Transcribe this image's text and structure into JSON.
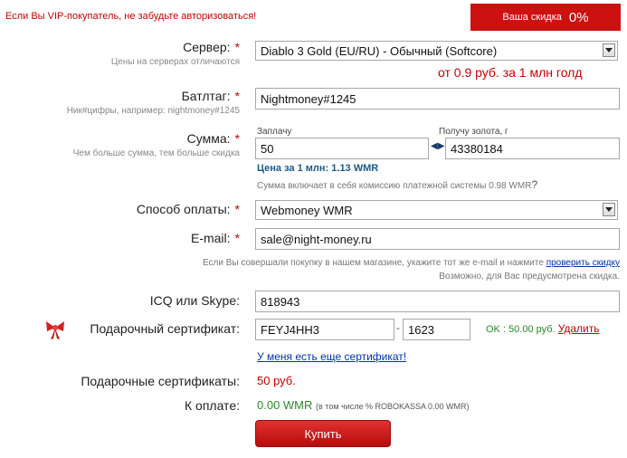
{
  "vip_notice": "Если Вы VIP-покупатель, не забудьте авторизоваться!",
  "discount": {
    "label": "Ваша скидка",
    "value": "0%"
  },
  "server": {
    "label": "Сервер:",
    "hint": "Цены на серверах отличаются",
    "selected": "Diablo 3 Gold (EU/RU) - Обычный (Softcore)",
    "price": "от 0.9 руб. за 1 млн голд"
  },
  "battletag": {
    "label": "Батлтаг:",
    "hint": "Ник#цифры, например: nightmoney#1245",
    "value": "Nightmoney#1245"
  },
  "sum": {
    "label": "Сумма:",
    "hint": "Чем больше сумма, тем больше скидка",
    "pay_label": "Заплачу",
    "pay_value": "50",
    "receive_label": "Получу золота, г",
    "receive_value": "43380184",
    "price_line": "Цена за 1 млн: 1.13 WMR",
    "commission_note": "Сумма включает в себя комиссию платежной системы 0.98 WMR",
    "question": "?"
  },
  "payment": {
    "label": "Способ оплаты:",
    "selected": "Webmoney WMR"
  },
  "email": {
    "label": "E-mail:",
    "value": "sale@night-money.ru",
    "note_line1": "Если Вы совершали покупку в нашем магазине, укажите тот же e-mail и нажмите",
    "check_link": "проверить скидку",
    "note_line2": "Возможно, для Вас предусмотрена скидка."
  },
  "contact": {
    "label": "ICQ или Skype:",
    "value": "818943"
  },
  "gift": {
    "label": "Подарочный сертификат:",
    "code": "FEYJ4HH3",
    "dash": "-",
    "pin": "1623",
    "status": "OK : 50.00 руб.",
    "remove_link": "Удалить",
    "more_link": "У меня есть еще сертификат!",
    "bow_icon": "gift-bow-icon"
  },
  "gift_total": {
    "label": "Подарочные сертификаты:",
    "value": "50 руб."
  },
  "to_pay": {
    "label": "К оплате:",
    "value": "0.00 WMR",
    "note": "(в том числе % ROBOKASSA 0.00 WMR)"
  },
  "buy_button": "Купить",
  "colors": {
    "accent": "#cc1111",
    "link": "#0033aa",
    "price_blue": "#1a5a8a",
    "ok_green": "#2a8a2a"
  }
}
